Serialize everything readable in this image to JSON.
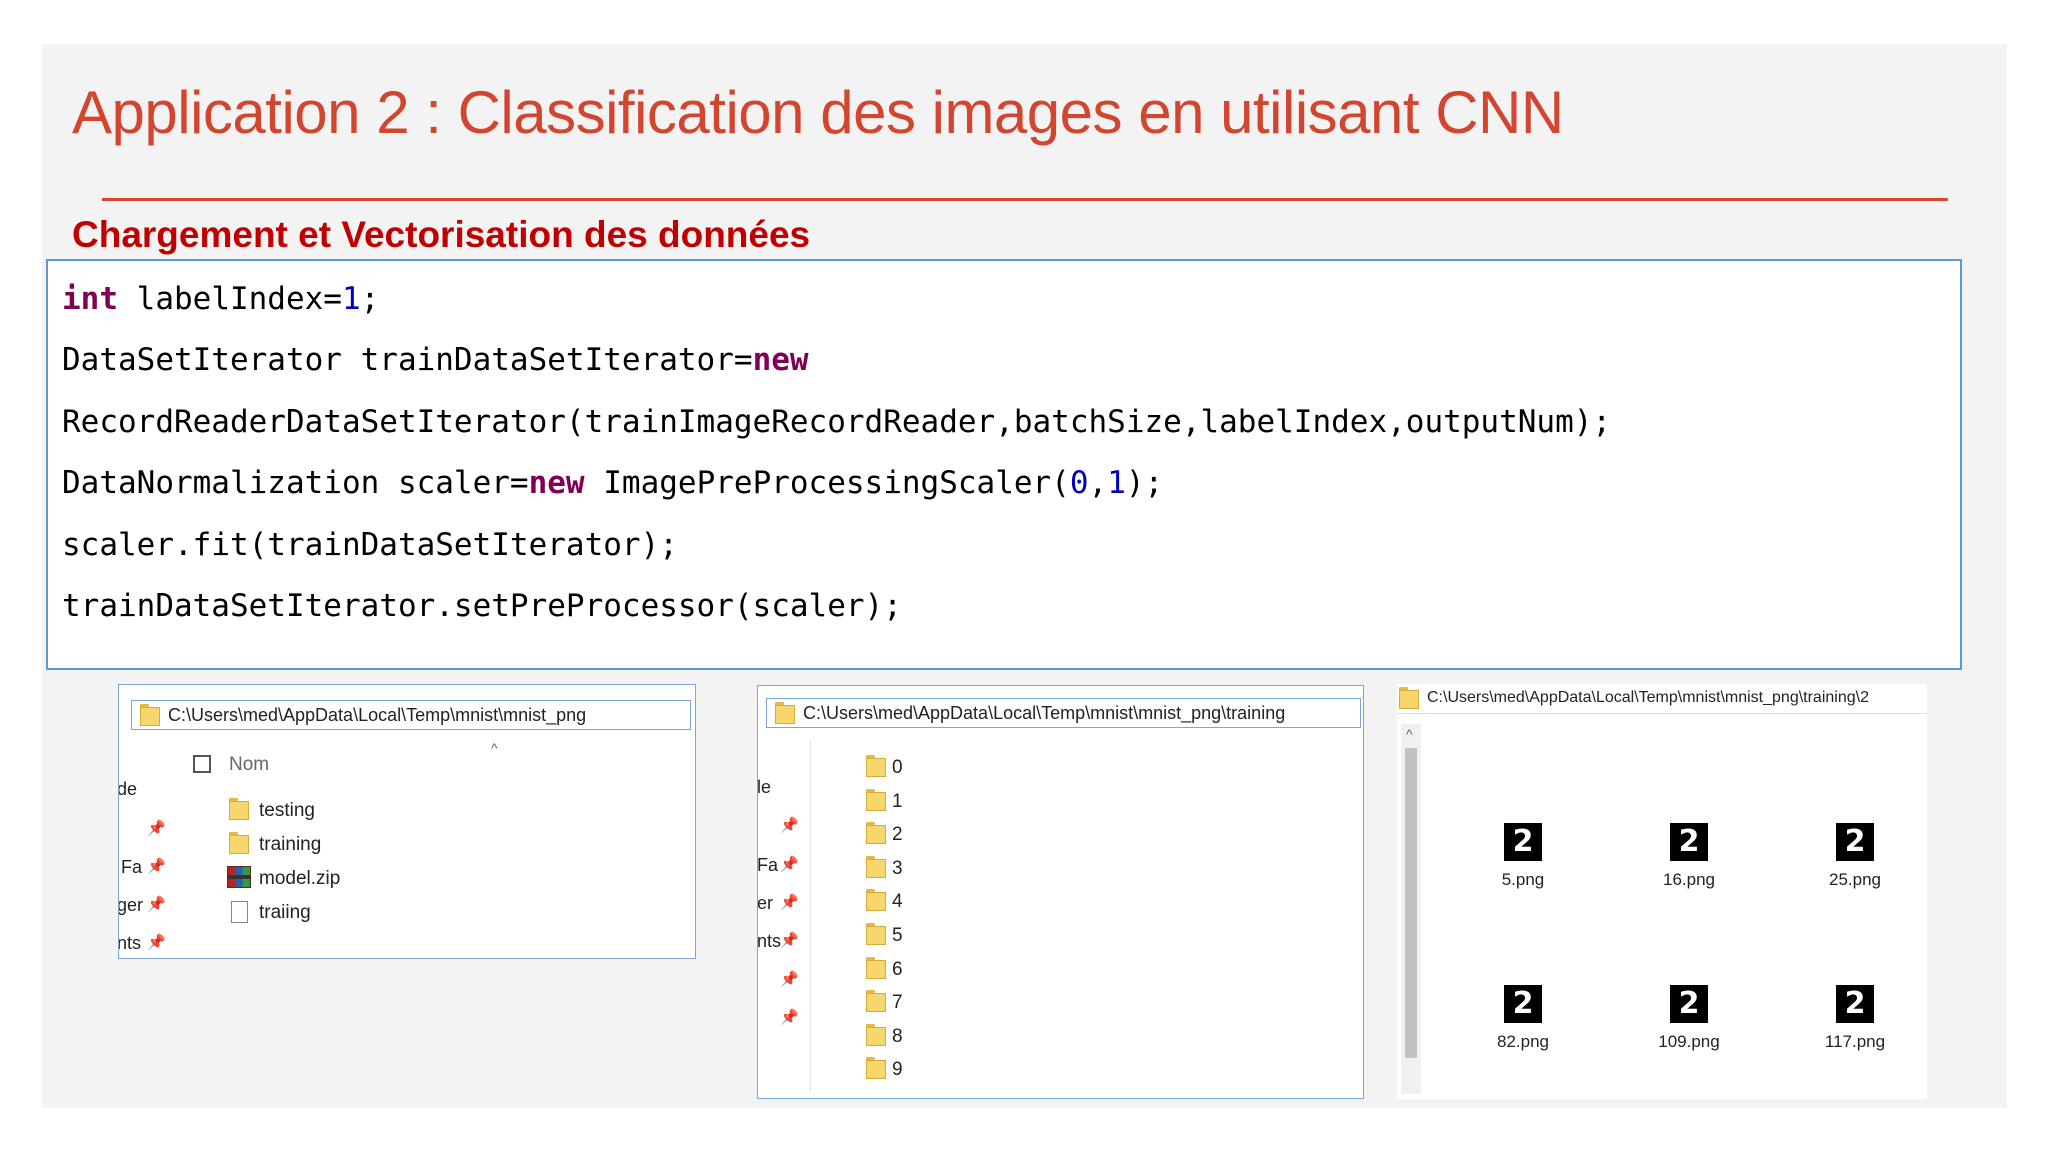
{
  "title": "Application 2 : Classification des images en utilisant CNN",
  "subtitle": "Chargement et Vectorisation des données",
  "code": {
    "line1": {
      "kw": "int",
      "a": " labelIndex=",
      "n1": "1",
      "b": ";"
    },
    "line2": {
      "a": "DataSetIterator trainDataSetIterator=",
      "kw": "new"
    },
    "line3": {
      "a": "RecordReaderDataSetIterator(trainImageRecordReader,batchSize,labelIndex,outputNum);"
    },
    "line4": {
      "a": "DataNormalization scaler=",
      "kw": "new",
      "b": " ImagePreProcessingScaler(",
      "n1": "0",
      "c": ",",
      "n2": "1",
      "d": ");"
    },
    "line5": {
      "a": "scaler.fit(trainDataSetIterator);"
    },
    "line6": {
      "a": "trainDataSetIterator.setPreProcessor(scaler);"
    }
  },
  "explorer1": {
    "path": "C:\\Users\\med\\AppData\\Local\\Temp\\mnist\\mnist_png",
    "column_header": "Nom",
    "side_labels": [
      "de",
      "Fa",
      "ger",
      "nts"
    ],
    "items": [
      {
        "name": "testing",
        "icon": "folder-icon"
      },
      {
        "name": "training",
        "icon": "folder-icon"
      },
      {
        "name": "model.zip",
        "icon": "zip-archive-icon"
      },
      {
        "name": "traiing",
        "icon": "file-icon"
      }
    ]
  },
  "explorer2": {
    "path": "C:\\Users\\med\\AppData\\Local\\Temp\\mnist\\mnist_png\\training",
    "side_labels": [
      "le",
      "Fa",
      "er",
      "nts"
    ],
    "folders": [
      "0",
      "1",
      "2",
      "3",
      "4",
      "5",
      "6",
      "7",
      "8",
      "9"
    ]
  },
  "explorer3": {
    "path": "C:\\Users\\med\\AppData\\Local\\Temp\\mnist\\mnist_png\\training\\2",
    "images": [
      {
        "name": "5.png",
        "digit": "2"
      },
      {
        "name": "16.png",
        "digit": "2"
      },
      {
        "name": "25.png",
        "digit": "2"
      },
      {
        "name": "82.png",
        "digit": "2"
      },
      {
        "name": "109.png",
        "digit": "2"
      },
      {
        "name": "117.png",
        "digit": "2"
      }
    ]
  },
  "colors": {
    "title": "#d2452f",
    "subtitle": "#c00000",
    "keyword": "#7f0055",
    "number": "#0000c0",
    "border": "#5b9bd5"
  }
}
